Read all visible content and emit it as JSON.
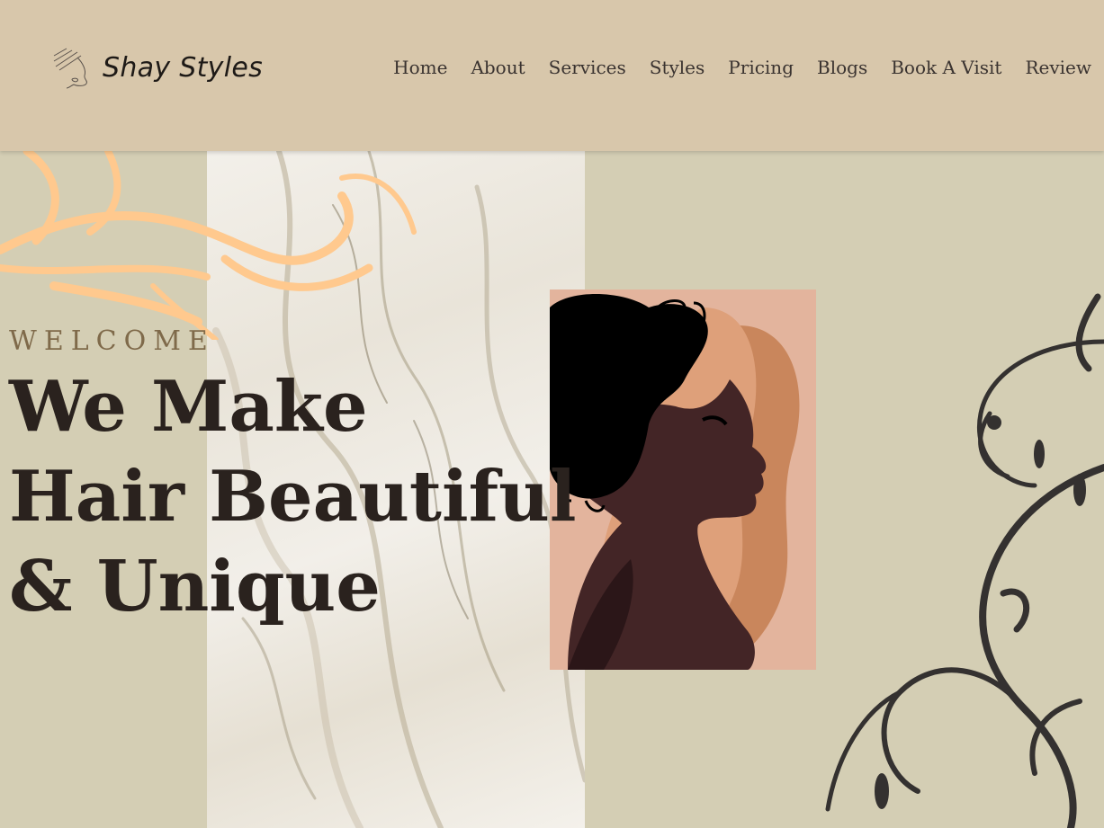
{
  "brand": {
    "name": "Shay Styles",
    "icon": "face-line-art-icon"
  },
  "nav": {
    "items": [
      {
        "label": "Home"
      },
      {
        "label": "About"
      },
      {
        "label": "Services"
      },
      {
        "label": "Styles"
      },
      {
        "label": "Pricing"
      },
      {
        "label": "Blogs"
      },
      {
        "label": "Book A Visit"
      },
      {
        "label": "Review"
      }
    ]
  },
  "hero": {
    "eyebrow": "WELCOME",
    "headline_lines": [
      "We Make",
      "Hair Beautiful",
      "& Unique"
    ],
    "illustration": "woman-profile-illustration"
  },
  "colors": {
    "header_bg": "#d8c7ab",
    "page_bg": "#d4ceb4",
    "accent_orange": "#ffc98e",
    "text_dark": "#2a221e",
    "eyebrow": "#7f6a4a"
  }
}
